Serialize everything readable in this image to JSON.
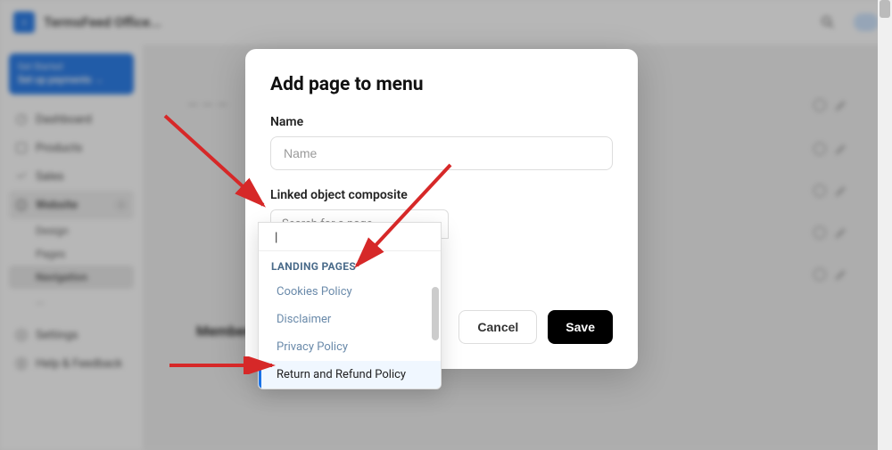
{
  "header": {
    "app_title": "TermsFeed Office..."
  },
  "sidebar": {
    "promo_tag": "Get Started",
    "promo_title": "Set up payments →",
    "items": [
      {
        "label": "Dashboard"
      },
      {
        "label": "Products"
      },
      {
        "label": "Sales"
      },
      {
        "label": "Website"
      }
    ],
    "subitems": [
      {
        "label": "Design"
      },
      {
        "label": "Pages"
      },
      {
        "label": "Navigation"
      },
      {
        "label": "..."
      }
    ],
    "settings": "Settings",
    "help": "Help & Feedback"
  },
  "main": {
    "member_menu": "Member Menu"
  },
  "modal": {
    "title": "Add page to menu",
    "name_label": "Name",
    "name_placeholder": "Name",
    "linked_label": "Linked object composite",
    "search_placeholder": "Search for a page",
    "cancel": "Cancel",
    "save": "Save"
  },
  "dropdown": {
    "group_header": "LANDING PAGES",
    "options": [
      "Cookies Policy",
      "Disclaimer",
      "Privacy Policy",
      "Return and Refund Policy"
    ]
  }
}
